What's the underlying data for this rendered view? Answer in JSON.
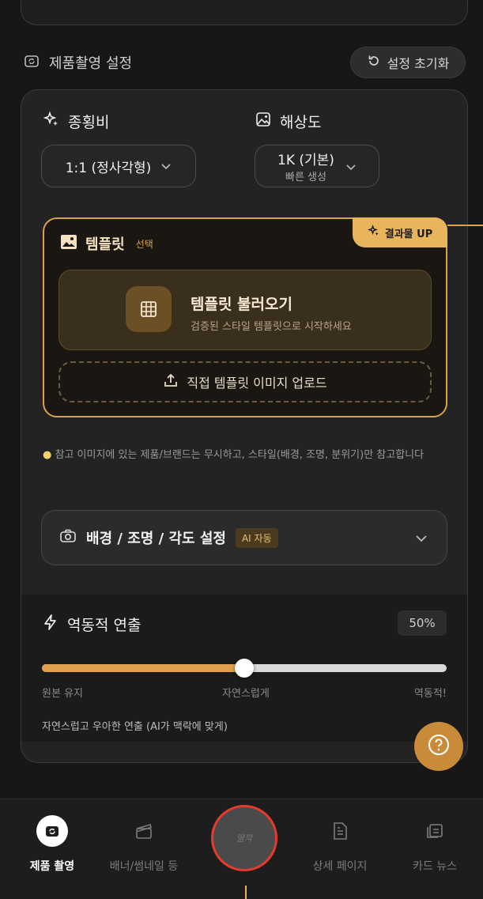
{
  "section": {
    "title": "제품촬영 설정",
    "reset_label": "설정 초기화"
  },
  "aspect": {
    "label": "종횡비",
    "value": "1:1 (정사각형)"
  },
  "resolution": {
    "label": "해상도",
    "value": "1K (기본)",
    "sub": "빠른 생성"
  },
  "template": {
    "badge": "결과물 UP",
    "title": "템플릿",
    "optional": "선택",
    "load_title": "템플릿 불러오기",
    "load_desc": "검증된 스타일 템플릿으로 시작하세요",
    "upload_label": "직접 템플릿 이미지 업로드"
  },
  "tip": "참고 이미지에 있는 제품/브랜드는 무시하고, 스타일(배경, 조명, 분위기)만 참고합니다",
  "scene": {
    "label": "배경 / 조명 / 각도 설정",
    "tag": "AI 자동"
  },
  "dynamic": {
    "label": "역동적 연출",
    "percent_label": "50%",
    "value": 0.5,
    "left": "원본 유지",
    "middle": "자연스럽게",
    "right": "역동적!",
    "desc": "자연스럽고 우아한 연출 (AI가 맥락에 맞게)"
  },
  "nav": {
    "items": [
      {
        "label": "제품 촬영"
      },
      {
        "label": "배너/썸네일 등"
      },
      {
        "label": "상세 페이지"
      },
      {
        "label": "카드 뉴스"
      }
    ],
    "center_label": "딸깍"
  },
  "colors": {
    "accent": "#d9a24a",
    "background": "#171717",
    "annotation_red": "#e53a2c"
  }
}
